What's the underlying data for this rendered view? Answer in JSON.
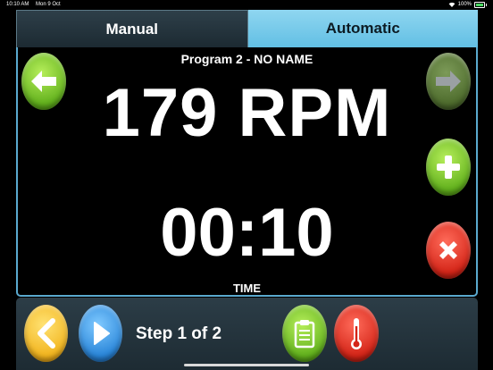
{
  "status_bar": {
    "time": "10:10 AM",
    "date": "Mon 9 Oct",
    "battery": "100%"
  },
  "tabs": [
    {
      "label": "Manual",
      "selected": false
    },
    {
      "label": "Automatic",
      "selected": true
    }
  ],
  "program": {
    "title": "Program 2 - NO NAME",
    "rpm": "179 RPM",
    "time": "00:10",
    "time_label": "TIME"
  },
  "step": {
    "text": "Step 1 of 2"
  },
  "icons": {
    "left": "arrow-left-icon",
    "right": "arrow-right-icon",
    "add": "plus-icon",
    "delete": "x-icon",
    "prev_step": "chevron-left-icon",
    "next_step": "play-icon",
    "clipboard": "clipboard-icon",
    "thermometer": "thermometer-icon"
  },
  "colors": {
    "accent_blue": "#62bfe4",
    "green": "#62b11d",
    "red": "#d42518",
    "yellow": "#f2b51f",
    "blue": "#2a86d9"
  }
}
